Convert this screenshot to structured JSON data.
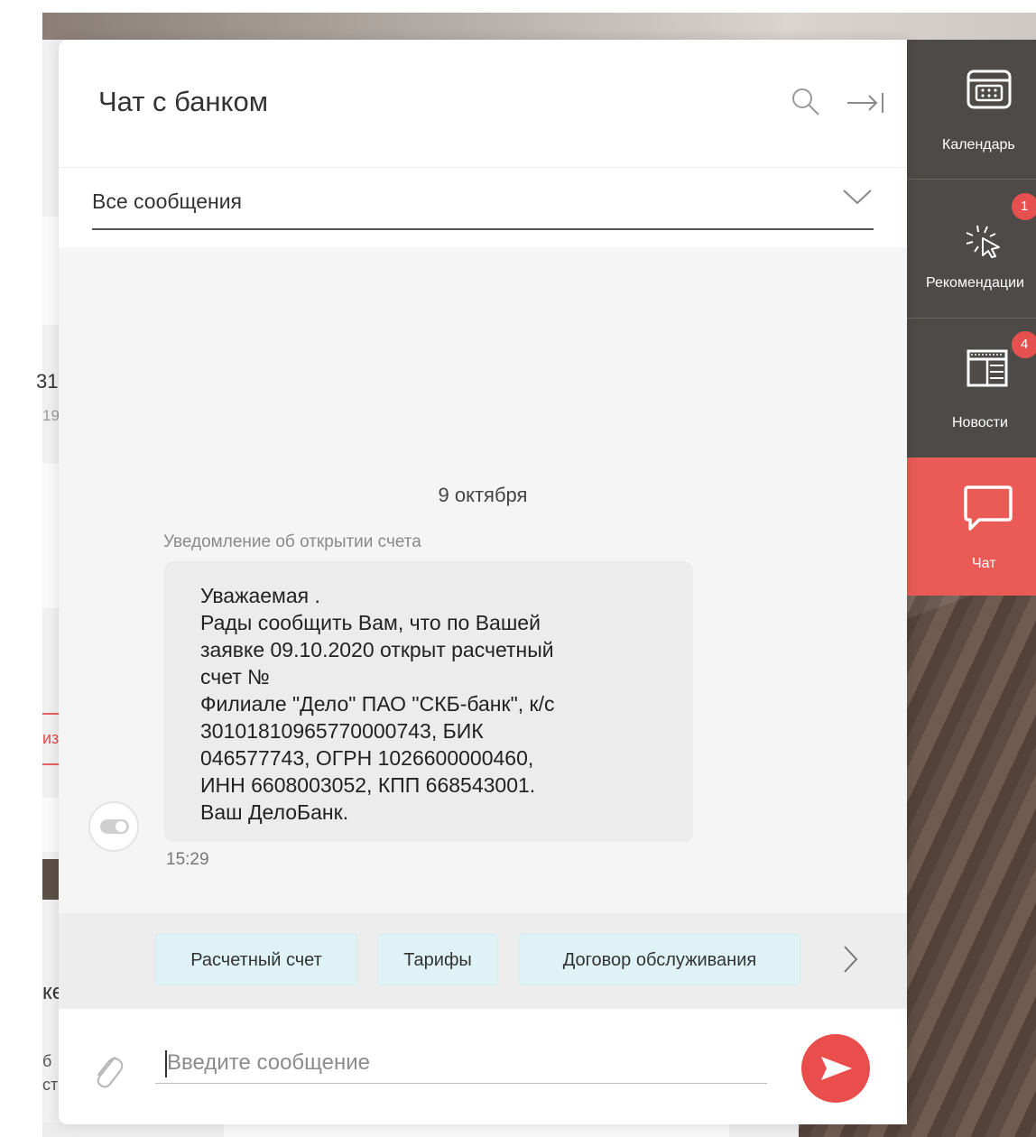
{
  "background": {
    "fragments": [
      "31",
      "19",
      "из",
      "ке",
      "б",
      "ст"
    ]
  },
  "chat": {
    "title": "Чат с банком",
    "filter": {
      "selected": "Все сообщения"
    },
    "messages": [
      {
        "date": "9 октября",
        "caption": "Уведомление об открытии счета",
        "lines": [
          "Уважаемая .",
          "Рады сообщить Вам, что по Вашей",
          "заявке 09.10.2020 открыт расчетный",
          "счет №",
          "Филиале \"Дело\" ПАО \"СКБ-банк\", к/с",
          "30101810965770000743, БИК",
          "046577743, ОГРН 1026600000460,",
          "ИНН 6608003052, КПП 668543001.",
          "Ваш ДелоБанк."
        ],
        "time": "15:29"
      }
    ],
    "quick_replies": [
      "Расчетный счет",
      "Тарифы",
      "Договор обслуживания"
    ],
    "composer": {
      "placeholder": "Введите сообщение"
    }
  },
  "rail": {
    "items": [
      {
        "label": "Календарь",
        "icon": "calendar-icon",
        "badge": null
      },
      {
        "label": "Рекомендации",
        "icon": "sparkle-cursor-icon",
        "badge": "1"
      },
      {
        "label": "Новости",
        "icon": "newspaper-icon",
        "badge": "4"
      },
      {
        "label": "Чат",
        "icon": "chat-bubble-icon",
        "badge": null,
        "active": true
      }
    ]
  },
  "colors": {
    "accent": "#ea5b56",
    "rail_bg": "#4e4a47",
    "chip_bg": "#dff3f7"
  }
}
